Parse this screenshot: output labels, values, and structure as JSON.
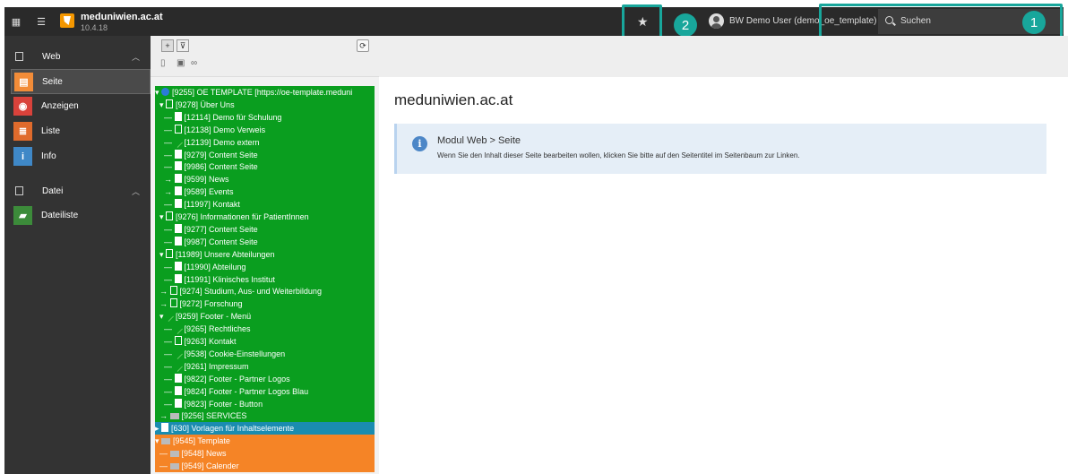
{
  "topbar": {
    "site_name": "meduniwien.ac.at",
    "site_version": "10.4.18",
    "star_glyph": "★",
    "user_name": "BW Demo User (demo_oe_template)",
    "search_placeholder": "Suchen",
    "icons": [
      "module-menu-icon",
      "list-icon",
      "typo3-logo-icon",
      "bookmark-star-icon",
      "user-avatar-icon",
      "search-icon"
    ]
  },
  "callouts": [
    {
      "number": "1",
      "color": "#18a69b"
    },
    {
      "number": "2",
      "color": "#18a69b"
    }
  ],
  "module_menu": {
    "groups": [
      {
        "label": "Web",
        "chevron": "︿"
      },
      {
        "label": "Datei",
        "chevron": "︿"
      }
    ],
    "items": [
      {
        "label": "Seite",
        "icon": "page-icon",
        "color": "#f28c38",
        "active": true
      },
      {
        "label": "Anzeigen",
        "icon": "eye-icon",
        "color": "#d9423b",
        "active": false
      },
      {
        "label": "Liste",
        "icon": "list-module-icon",
        "color": "#e06b2c",
        "active": false
      },
      {
        "label": "Info",
        "icon": "info-icon",
        "color": "#3f88c7",
        "active": false
      },
      {
        "label": "Dateiliste",
        "icon": "filelist-icon",
        "color": "#3c8b3a",
        "active": false
      }
    ]
  },
  "tree_toolbar": {
    "filter_glyph": "⊽",
    "refresh_glyph": "⟳",
    "new_page_glyph": "🗋"
  },
  "page_tree": {
    "colors": {
      "green": "#0a9e1f",
      "blue": "#1a8cb0",
      "orange": "#f58426"
    },
    "rows": [
      {
        "prefix": "▾ ",
        "icon": "globe",
        "text": "[9255] OE TEMPLATE [https://oe-template.meduni",
        "bg": "green"
      },
      {
        "prefix": "  ▾ ",
        "icon": "shortcut",
        "text": "[9278] Über Uns",
        "bg": "green"
      },
      {
        "prefix": "    — ",
        "icon": "page",
        "text": "[12114] Demo für Schulung",
        "bg": "green"
      },
      {
        "prefix": "    — ",
        "icon": "shortcut",
        "text": "[12138] Demo Verweis",
        "bg": "green"
      },
      {
        "prefix": "    — ",
        "icon": "link",
        "text": "[12139] Demo extern",
        "bg": "green"
      },
      {
        "prefix": "    — ",
        "icon": "page",
        "text": "[9279] Content Seite",
        "bg": "green"
      },
      {
        "prefix": "    — ",
        "icon": "page",
        "text": "[9986] Content Seite",
        "bg": "green"
      },
      {
        "prefix": "    → ",
        "icon": "page",
        "text": "[9599] News",
        "bg": "green"
      },
      {
        "prefix": "    → ",
        "icon": "page",
        "text": "[9589] Events",
        "bg": "green"
      },
      {
        "prefix": "    — ",
        "icon": "page",
        "text": "[11997] Kontakt",
        "bg": "green"
      },
      {
        "prefix": "  ▾ ",
        "icon": "shortcut",
        "text": "[9276] Informationen für PatientInnen",
        "bg": "green"
      },
      {
        "prefix": "    — ",
        "icon": "page",
        "text": "[9277] Content Seite",
        "bg": "green"
      },
      {
        "prefix": "    — ",
        "icon": "page",
        "text": "[9987] Content Seite",
        "bg": "green"
      },
      {
        "prefix": "  ▾ ",
        "icon": "shortcut",
        "text": "[11989] Unsere Abteilungen",
        "bg": "green"
      },
      {
        "prefix": "    — ",
        "icon": "page",
        "text": "[11990] Abteilung",
        "bg": "green"
      },
      {
        "prefix": "    — ",
        "icon": "page",
        "text": "[11991] Klinisches Institut",
        "bg": "green"
      },
      {
        "prefix": "  → ",
        "icon": "shortcut",
        "text": "[9274] Studium, Aus- und Weiterbildung",
        "bg": "green"
      },
      {
        "prefix": "  → ",
        "icon": "shortcut",
        "text": "[9272] Forschung",
        "bg": "green"
      },
      {
        "prefix": "  ▾ ",
        "icon": "link",
        "text": "[9259] Footer - Menü",
        "bg": "green"
      },
      {
        "prefix": "    — ",
        "icon": "link",
        "text": "[9265] Rechtliches",
        "bg": "green"
      },
      {
        "prefix": "    — ",
        "icon": "shortcut",
        "text": "[9263] Kontakt",
        "bg": "green"
      },
      {
        "prefix": "    — ",
        "icon": "link",
        "text": "[9538] Cookie-Einstellungen",
        "bg": "green"
      },
      {
        "prefix": "    — ",
        "icon": "link",
        "text": "[9261] Impressum",
        "bg": "green"
      },
      {
        "prefix": "    — ",
        "icon": "page",
        "text": "[9822] Footer - Partner Logos",
        "bg": "green"
      },
      {
        "prefix": "    — ",
        "icon": "page",
        "text": "[9824] Footer - Partner Logos Blau",
        "bg": "green"
      },
      {
        "prefix": "    — ",
        "icon": "page",
        "text": "[9823] Footer - Button",
        "bg": "green"
      },
      {
        "prefix": "  → ",
        "icon": "folder",
        "text": "[9256] SERVICES",
        "bg": "green"
      },
      {
        "prefix": "▸ ",
        "icon": "page",
        "text": "[630] Vorlagen für Inhaltselemente",
        "bg": "blue"
      },
      {
        "prefix": "▾ ",
        "icon": "folder",
        "text": "[9545] Template",
        "bg": "orange"
      },
      {
        "prefix": "  — ",
        "icon": "folder",
        "text": "[9548] News",
        "bg": "orange"
      },
      {
        "prefix": "  — ",
        "icon": "folder",
        "text": "[9549] Calender",
        "bg": "orange"
      }
    ]
  },
  "content": {
    "page_title": "meduniwien.ac.at",
    "info_title": "Modul Web > Seite",
    "info_text": "Wenn Sie den Inhalt dieser Seite bearbeiten wollen, klicken Sie bitte auf den Seitentitel im Seitenbaum zur Linken.",
    "info_glyph": "i"
  }
}
